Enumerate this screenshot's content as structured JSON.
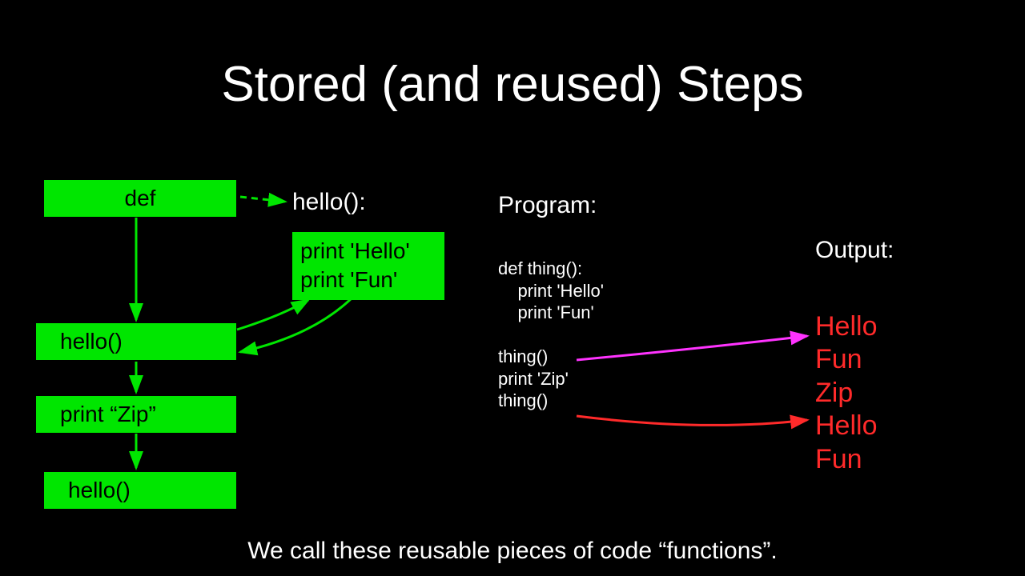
{
  "title": "Stored (and reused) Steps",
  "boxes": {
    "def": "def",
    "hello_decl": "hello():",
    "body_line1": "print 'Hello'",
    "body_line2": "print 'Fun'",
    "hello_call1": "hello()",
    "print_zip": "print “Zip”",
    "hello_call2": "hello()"
  },
  "program": {
    "label": "Program:",
    "code": "def thing():\n    print 'Hello'\n    print 'Fun'\n\nthing()\nprint 'Zip'\nthing()"
  },
  "output": {
    "label": "Output:",
    "lines": [
      "Hello",
      "Fun",
      "Zip",
      "Hello",
      "Fun"
    ]
  },
  "footer": "We call these reusable pieces of code “functions”."
}
